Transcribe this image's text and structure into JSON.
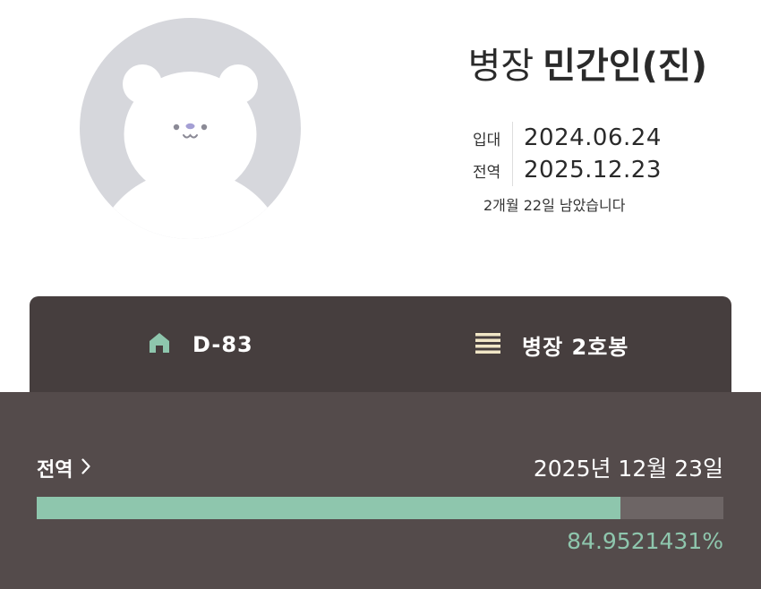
{
  "profile": {
    "rank": "병장",
    "name": "민간인(진)",
    "avatar_icon": "bear-avatar-icon"
  },
  "dates": {
    "enlist_label": "입대",
    "enlist_value": "2024.06.24",
    "discharge_label": "전역",
    "discharge_value": "2025.12.23",
    "remaining_text": "2개월 22일 남았습니다"
  },
  "tabs": [
    {
      "icon": "home-icon",
      "label": "D-83"
    },
    {
      "icon": "menu-lines-icon",
      "label": "병장 2호봉"
    }
  ],
  "progress": {
    "title": "전역",
    "target_date": "2025년 12월 23일",
    "percent_text": "84.9521431%",
    "fraction": 0.849521431
  },
  "colors": {
    "accent": "#8ec6ad",
    "tab_bg": "#463e3e",
    "panel_bg": "#544b4b",
    "track": "#6d6565",
    "avatar_bg": "#d6d7dc",
    "rank_icon": "#f1e6c6"
  }
}
